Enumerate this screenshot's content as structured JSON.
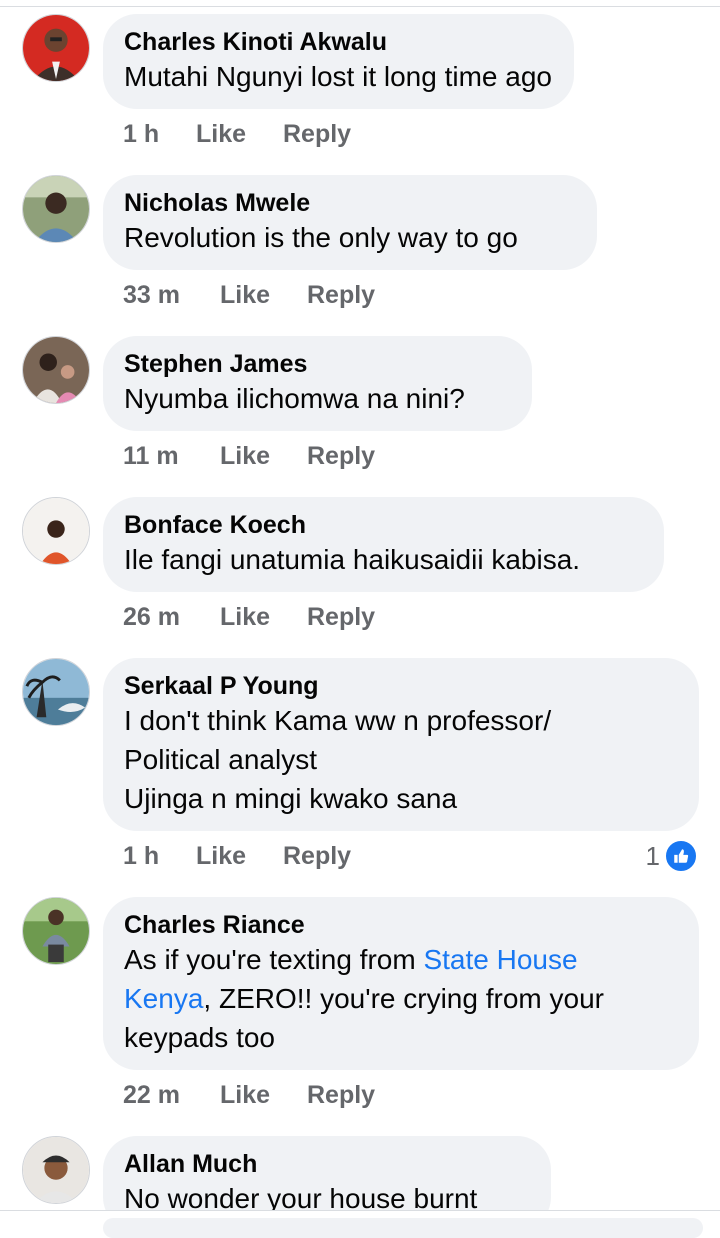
{
  "colors": {
    "bubble": "#f0f2f5",
    "meta": "#65676b",
    "link": "#1877f2",
    "text": "#050505"
  },
  "comments": [
    {
      "author": "Charles Kinoti Akwalu",
      "lines": [
        "Mutahi Ngunyi lost it long time ago"
      ],
      "time": "1 h",
      "like": "Like",
      "reply": "Reply"
    },
    {
      "author": "Nicholas Mwele",
      "lines": [
        "Revolution is the only way to go"
      ],
      "time": "33 m",
      "like": "Like",
      "reply": "Reply"
    },
    {
      "author": "Stephen James",
      "lines": [
        "Nyumba ilichomwa na nini?"
      ],
      "time": "11 m",
      "like": "Like",
      "reply": "Reply"
    },
    {
      "author": "Bonface Koech",
      "lines": [
        "Ile fangi unatumia haikusaidii kabisa."
      ],
      "time": "26 m",
      "like": "Like",
      "reply": "Reply"
    },
    {
      "author": "Serkaal P Young",
      "lines": [
        "I don't think Kama ww n professor/",
        "Political analyst",
        "Ujinga n mingi kwako sana"
      ],
      "time": "1 h",
      "like": "Like",
      "reply": "Reply",
      "reaction_count": "1",
      "reaction_icon": "thumbs-up-icon"
    },
    {
      "author": "Charles Riance",
      "line1_pre": "As if you're texting from ",
      "line1_link": "State House",
      "line2_link": "Kenya",
      "line2_post": ", ZERO!! you're crying from your",
      "line3": "keypads too",
      "time": "22 m",
      "like": "Like",
      "reply": "Reply"
    },
    {
      "author": "Allan Much",
      "lines": [
        "No wonder your house burnt"
      ]
    }
  ]
}
